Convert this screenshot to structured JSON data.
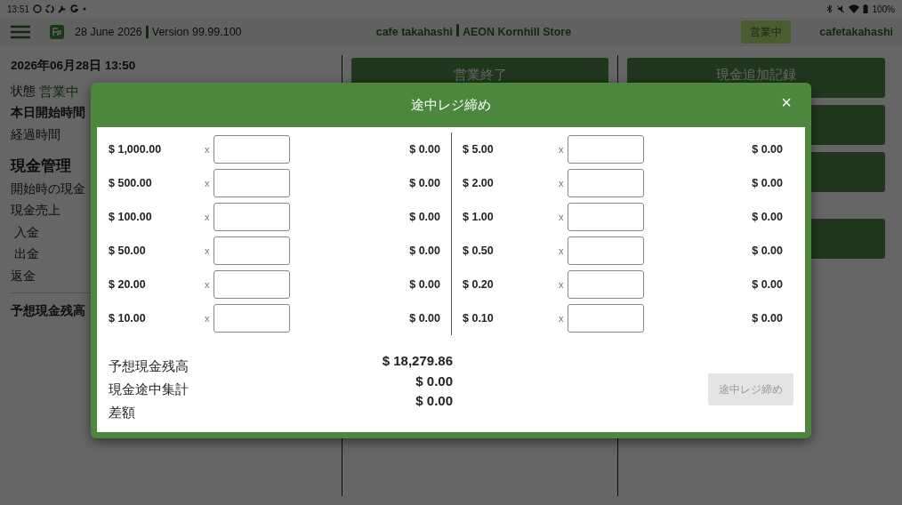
{
  "status_bar": {
    "time": "13:51",
    "battery": "100%"
  },
  "header": {
    "date": "28 June 2026",
    "version": "Version 99.99.100",
    "shop": "cafe takahashi",
    "store": "AEON Kornhill Store",
    "status_badge": "営業中",
    "user": "cafetakahashi"
  },
  "summary": {
    "datetime": "2026年06月28日 13:50",
    "state_label": "状態",
    "state_value": "営業中",
    "items": [
      {
        "kind": "bold",
        "text": "本日開始時間"
      },
      {
        "kind": "normal",
        "text": "経過時間"
      },
      {
        "kind": "heading",
        "text": "現金管理"
      },
      {
        "kind": "normal",
        "text": "開始時の現金"
      },
      {
        "kind": "normal",
        "text": "現金売上"
      },
      {
        "kind": "sub",
        "text": "入金"
      },
      {
        "kind": "sub",
        "text": "出金"
      },
      {
        "kind": "normal",
        "text": "返金"
      },
      {
        "kind": "total",
        "text": "予想現金残高"
      }
    ]
  },
  "middle_column": {
    "buttons": [
      {
        "kind": "button",
        "label": "営業終了"
      }
    ]
  },
  "right_column": {
    "buttons": [
      {
        "kind": "button",
        "label": "現金追加記録"
      },
      {
        "kind": "button"
      },
      {
        "kind": "button"
      },
      {
        "kind": "spaced-button"
      }
    ]
  },
  "modal": {
    "title": "途中レジ締め",
    "close": "×",
    "columns": [
      [
        {
          "denomination": "$ 1,000.00",
          "multiplier": "x",
          "total": "$ 0.00"
        },
        {
          "denomination": "$ 500.00",
          "multiplier": "x",
          "total": "$ 0.00"
        },
        {
          "denomination": "$ 100.00",
          "multiplier": "x",
          "total": "$ 0.00"
        },
        {
          "denomination": "$ 50.00",
          "multiplier": "x",
          "total": "$ 0.00"
        },
        {
          "denomination": "$ 20.00",
          "multiplier": "x",
          "total": "$ 0.00"
        },
        {
          "denomination": "$ 10.00",
          "multiplier": "x",
          "total": "$ 0.00"
        }
      ],
      [
        {
          "denomination": "$ 5.00",
          "multiplier": "x",
          "total": "$ 0.00"
        },
        {
          "denomination": "$ 2.00",
          "multiplier": "x",
          "total": "$ 0.00"
        },
        {
          "denomination": "$ 1.00",
          "multiplier": "x",
          "total": "$ 0.00"
        },
        {
          "denomination": "$ 0.50",
          "multiplier": "x",
          "total": "$ 0.00"
        },
        {
          "denomination": "$ 0.20",
          "multiplier": "x",
          "total": "$ 0.00"
        },
        {
          "denomination": "$ 0.10",
          "multiplier": "x",
          "total": "$ 0.00"
        }
      ]
    ],
    "totals": [
      {
        "label": "予想現金残高",
        "value": "$ 18,279.86"
      },
      {
        "label": "現金途中集計",
        "value": "$ 0.00"
      },
      {
        "label": "差額",
        "value": "$ 0.00"
      }
    ],
    "submit": {
      "label": "途中レジ締め",
      "disabled": true
    }
  }
}
